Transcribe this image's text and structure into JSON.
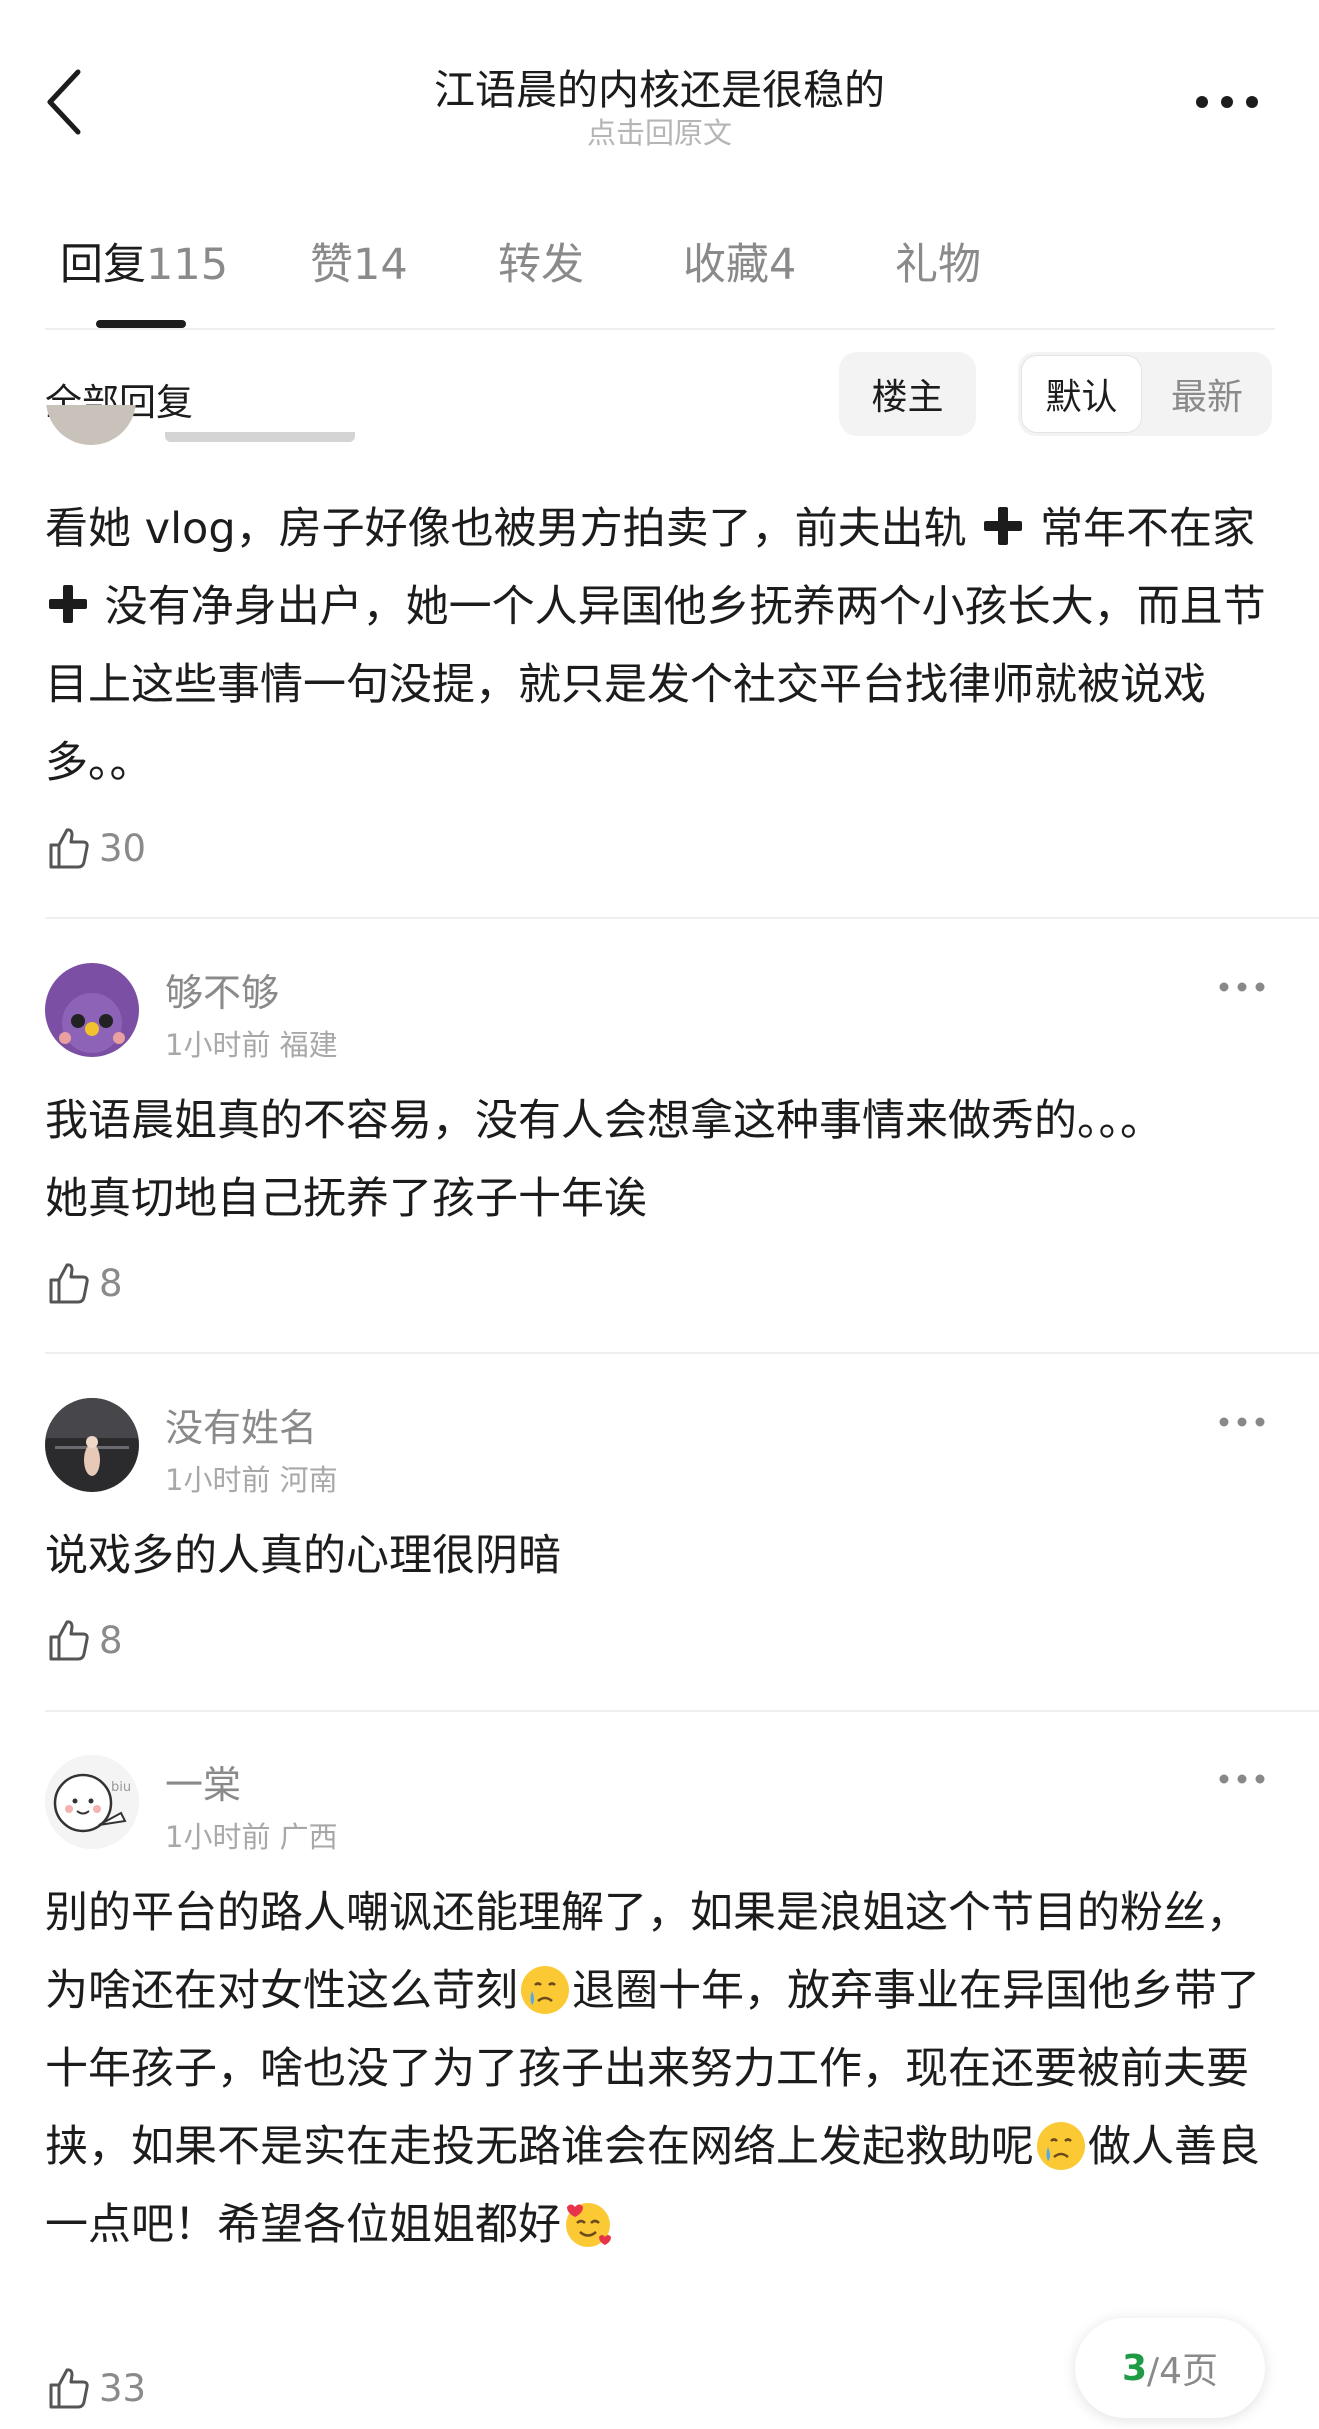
{
  "header": {
    "title": "江语晨的内核还是很稳的",
    "subtitle": "点击回原文"
  },
  "tabs": [
    {
      "label": "回复",
      "count": "115",
      "active": true
    },
    {
      "label": "赞",
      "count": "14"
    },
    {
      "label": "转发",
      "count": ""
    },
    {
      "label": "收藏",
      "count": "4"
    },
    {
      "label": "礼物",
      "count": ""
    }
  ],
  "filter": {
    "label": "全部回复",
    "owner": "楼主",
    "sort_default": "默认",
    "sort_latest": "最新"
  },
  "comments": [
    {
      "text_parts": [
        "看她 vlog，房子好像也被男方拍卖了，前夫出轨 ",
        " 常年不在家 ",
        " 没有净身出户，她一个人异国他乡抚养两个小孩长大，而且节目上这些事情一句没提，就只是发个社交平台找律师就被说戏多。。"
      ],
      "likes": "30"
    },
    {
      "username": "够不够",
      "time": "1小时前",
      "location": "福建",
      "text": "我语晨姐真的不容易，没有人会想拿这种事情来做秀的。。。她真切地自己抚养了孩子十年诶",
      "likes": "8"
    },
    {
      "username": "没有姓名",
      "time": "1小时前",
      "location": "河南",
      "text": "说戏多的人真的心理很阴暗",
      "likes": "8"
    },
    {
      "username": "一棠",
      "time": "1小时前",
      "location": "广西",
      "text_parts": [
        "别的平台的路人嘲讽还能理解了，如果是浪姐这个节目的粉丝，为啥还在对女性这么苛刻",
        "退圈十年，放弃事业在异国他乡带了十年孩子，啥也没了为了孩子出来努力工作，现在还要被前夫要挟，如果不是实在走投无路谁会在网络上发起救助呢",
        "做人善良一点吧！希望各位姐姐都好",
        ""
      ],
      "likes": "33"
    }
  ],
  "pager": {
    "current": "3",
    "total": "/4页"
  },
  "icons": [
    "back-arrow-icon",
    "more-dots-icon",
    "thumbs-up-icon",
    "heavy-plus-icon",
    "crying-face-icon",
    "smiling-hearts-icon"
  ]
}
